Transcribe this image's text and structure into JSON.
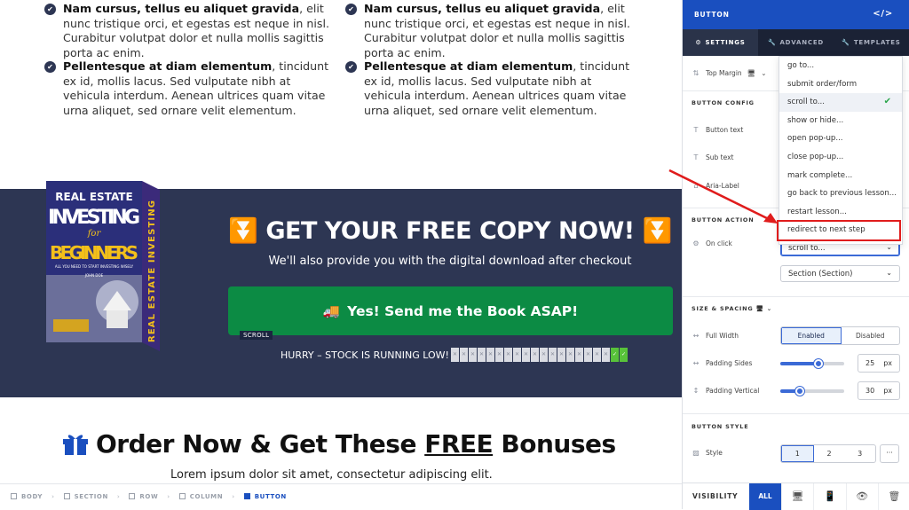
{
  "features": [
    {
      "bold": "Nam cursus, tellus eu aliquet gravida",
      "rest": ", elit nunc tristique orci, et egestas est neque in nisl. Curabitur volutpat dolor et nulla mollis sagittis porta ac enim."
    },
    {
      "bold": "Pellentesque at diam elementum",
      "rest": ", tincidunt ex id, mollis lacus. Sed vulputate nibh at vehicula interdum. Aenean ultrices quam vitae urna aliquet, sed ornare velit elementum."
    },
    {
      "bold": "Nam cursus, tellus eu aliquet gravida",
      "rest": ", elit nunc tristique orci, et egestas est neque in nisl. Curabitur volutpat dolor et nulla mollis sagittis porta ac enim."
    },
    {
      "bold": "Pellentesque at diam elementum",
      "rest": ", tincidunt ex id, mollis lacus. Sed vulputate nibh at vehicula interdum. Aenean ultrices quam vitae urna aliquet, sed ornare velit elementum."
    }
  ],
  "book": {
    "line1": "REAL ESTATE",
    "line2": "INVESTING",
    "line3": "for",
    "line4": "BEGINNERS",
    "tagline": "ALL YOU NEED TO START INVESTING WISELY",
    "author": "JOHN DOE",
    "spine": "REAL ESTATE INVESTING"
  },
  "banner": {
    "headline": "GET YOUR FREE COPY NOW!",
    "subline": "We'll also provide you with the digital download after checkout",
    "cta": "Yes! Send me the Book ASAP!",
    "scroll_tag": "SCROLL",
    "hurry": "HURRY – STOCK IS RUNNING LOW!"
  },
  "order": {
    "pre": "Order Now & Get These ",
    "free": "FREE",
    "post": " Bonuses"
  },
  "lorem": "Lorem ipsum dolor sit amet, consectetur adipiscing elit.",
  "breadcrumbs": [
    "BODY",
    "SECTION",
    "ROW",
    "COLUMN",
    "BUTTON"
  ],
  "panel": {
    "title": "BUTTON",
    "code_icon": "</>",
    "tabs": [
      "SETTINGS",
      "ADVANCED",
      "TEMPLATES"
    ],
    "top_margin": "Top Margin",
    "button_config": "BUTTON CONFIG",
    "button_text": "Button text",
    "sub_text": "Sub text",
    "aria_label": "Aria-Label",
    "button_action": "BUTTON ACTION",
    "on_click": "On click",
    "on_click_value": "scroll to...",
    "section_value": "Section (Section)",
    "size_spacing": "SIZE & SPACING",
    "full_width": "Full Width",
    "enabled": "Enabled",
    "disabled": "Disabled",
    "padding_sides": "Padding Sides",
    "padding_sides_value": "25",
    "padding_vertical": "Padding Vertical",
    "padding_vertical_value": "30",
    "px": "px",
    "button_style": "BUTTON STYLE",
    "style": "Style",
    "styles": [
      "1",
      "2",
      "3"
    ],
    "more": "···",
    "visibility": "VISIBILITY",
    "all": "ALL"
  },
  "dropdown": [
    "go to...",
    "submit order/form",
    "scroll to...",
    "show or hide...",
    "open pop-up...",
    "close pop-up...",
    "mark complete...",
    "go back to previous lesson...",
    "restart lesson...",
    "redirect to next step"
  ]
}
